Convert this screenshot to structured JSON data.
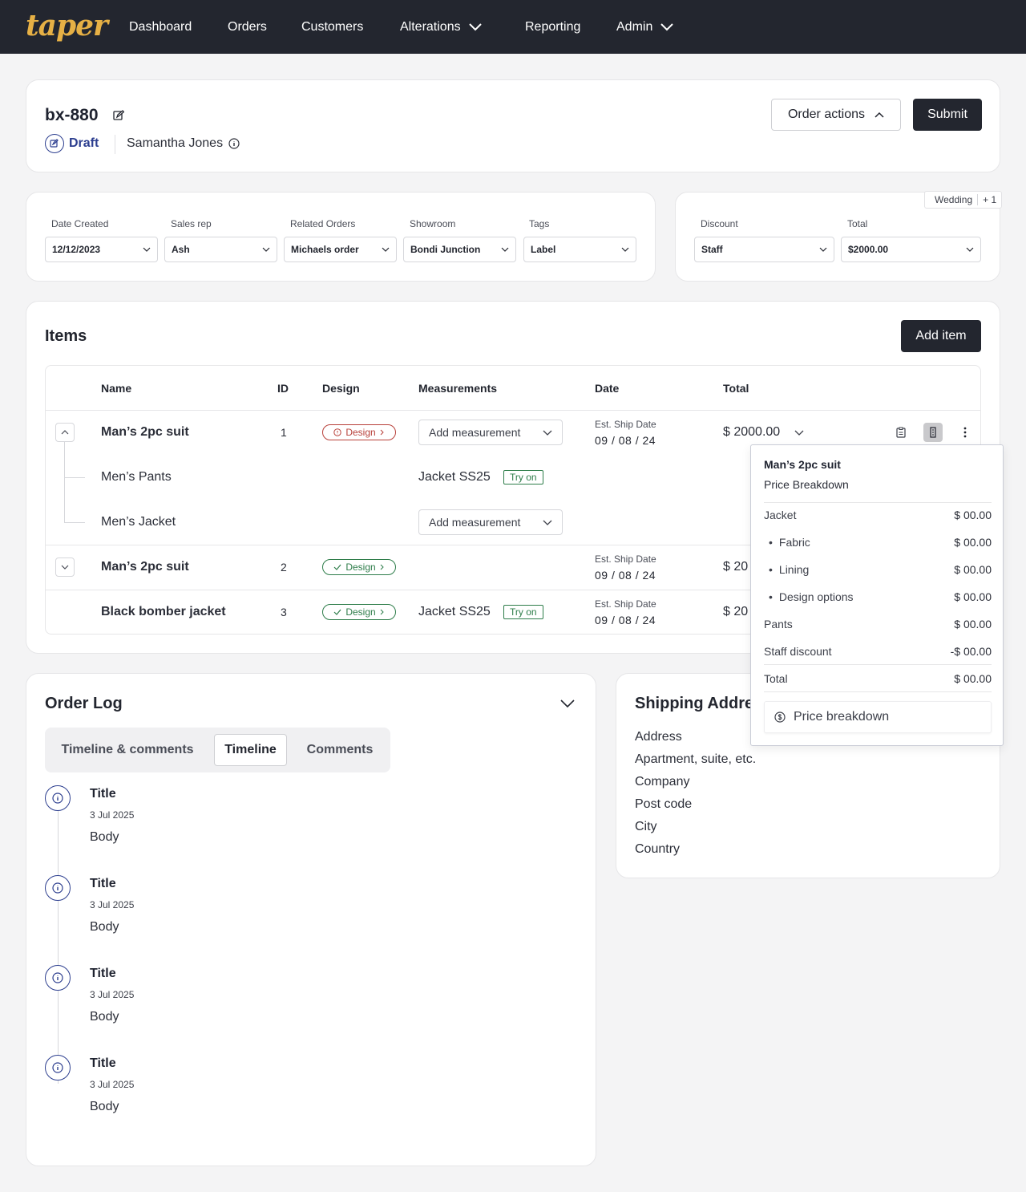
{
  "nav": {
    "logo": "taper",
    "items": [
      "Dashboard",
      "Orders",
      "Customers",
      "Alterations",
      "Reporting",
      "Admin"
    ]
  },
  "order": {
    "id": "bx-880",
    "status": "Draft",
    "customer": "Samantha Jones",
    "actions_label": "Order actions",
    "submit_label": "Submit"
  },
  "details": {
    "fields": [
      {
        "label": "Date Created",
        "value": "12/12/2023"
      },
      {
        "label": "Sales rep",
        "value": "Ash"
      },
      {
        "label": "Related Orders",
        "value": "Michaels order"
      },
      {
        "label": "Showroom",
        "value": "Bondi Junction"
      },
      {
        "label": "Tags",
        "value": "Label"
      }
    ]
  },
  "pricing": {
    "tag": "Wedding",
    "tag_more": "+ 1",
    "fields": [
      {
        "label": "Discount",
        "value": "Staff"
      },
      {
        "label": "Total",
        "value": "$2000.00"
      }
    ]
  },
  "items": {
    "title": "Items",
    "add_label": "Add item",
    "headers": [
      "Name",
      "ID",
      "Design",
      "Measurements",
      "Date",
      "Total"
    ],
    "rows": [
      {
        "name": "Man’s 2pc suit",
        "id": "1",
        "design": "Design",
        "measurement": "Add measurement",
        "ship_label": "Est. Ship Date",
        "ship_date": "09 / 08 / 24",
        "total": "$ 2000.00"
      },
      {
        "name": "Men’s Pants",
        "measurement": "Jacket SS25",
        "tryon": "Try on"
      },
      {
        "name": "Men’s Jacket",
        "measurement": "Add measurement"
      },
      {
        "name": "Man’s 2pc suit",
        "id": "2",
        "design": "Design",
        "ship_label": "Est. Ship Date",
        "ship_date": "09 / 08 / 24",
        "total": "$ 20"
      },
      {
        "name": "Black bomber jacket",
        "id": "3",
        "design": "Design",
        "measurement": "Jacket SS25",
        "tryon": "Try on",
        "ship_label": "Est. Ship Date",
        "ship_date": "09 / 08 / 24",
        "total": "$ 20"
      }
    ]
  },
  "price_popover": {
    "title": "Man’s 2pc suit",
    "subtitle": "Price Breakdown",
    "rows": [
      {
        "label": "Jacket",
        "value": "$ 00.00"
      },
      {
        "label": "Fabric",
        "value": "$ 00.00"
      },
      {
        "label": "Lining",
        "value": "$ 00.00"
      },
      {
        "label": "Design options",
        "value": "$ 00.00"
      },
      {
        "label": "Pants",
        "value": "$ 00.00"
      },
      {
        "label": "Staff discount",
        "value": "-$ 00.00"
      },
      {
        "label": "Total",
        "value": "$ 00.00"
      }
    ],
    "button_label": "Price breakdown"
  },
  "order_log": {
    "title": "Order Log",
    "tabs": [
      "Timeline & comments",
      "Timeline",
      "Comments"
    ],
    "active_tab": "Timeline",
    "entries": [
      {
        "title": "Title",
        "date": "3 Jul 2025",
        "body": "Body"
      },
      {
        "title": "Title",
        "date": "3 Jul 2025",
        "body": "Body"
      },
      {
        "title": "Title",
        "date": "3 Jul 2025",
        "body": "Body"
      },
      {
        "title": "Title",
        "date": "3 Jul 2025",
        "body": "Body"
      }
    ]
  },
  "shipping": {
    "title": "Shipping Address",
    "lines": [
      "Address",
      "Apartment, suite, etc.",
      "Company",
      "Post code",
      "City",
      "Country"
    ]
  },
  "colors": {
    "nav_bg": "#23262f",
    "logo": "#e6b045",
    "status_blue": "#2c3e8f",
    "design_red": "#b8403a",
    "design_green": "#2e7d4a"
  }
}
